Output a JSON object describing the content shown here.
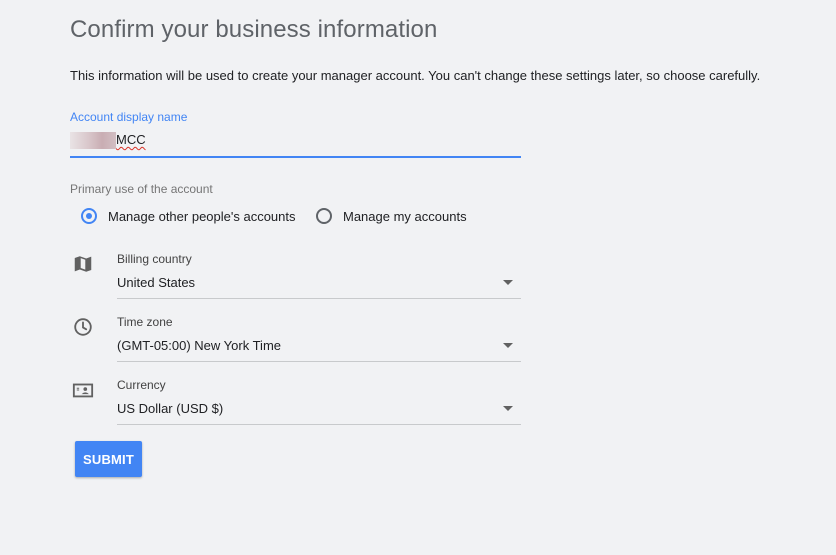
{
  "page": {
    "title": "Confirm your business information",
    "intro": "This information will be used to create your manager account. You can't change these settings later, so choose carefully."
  },
  "account_name": {
    "label": "Account display name",
    "value": "MCC"
  },
  "primary_use": {
    "label": "Primary use of the account",
    "options": [
      {
        "label": "Manage other people's accounts",
        "selected": true
      },
      {
        "label": "Manage my accounts",
        "selected": false
      }
    ]
  },
  "billing_country": {
    "icon": "map-icon",
    "label": "Billing country",
    "value": "United States"
  },
  "time_zone": {
    "icon": "clock-icon",
    "label": "Time zone",
    "value": "(GMT-05:00) New York Time"
  },
  "currency": {
    "icon": "currency-icon",
    "label": "Currency",
    "value": "US Dollar (USD $)"
  },
  "submit": {
    "label": "SUBMIT"
  },
  "colors": {
    "accent": "#4285f4",
    "background": "#f1f2f4",
    "icon": "#616161"
  }
}
